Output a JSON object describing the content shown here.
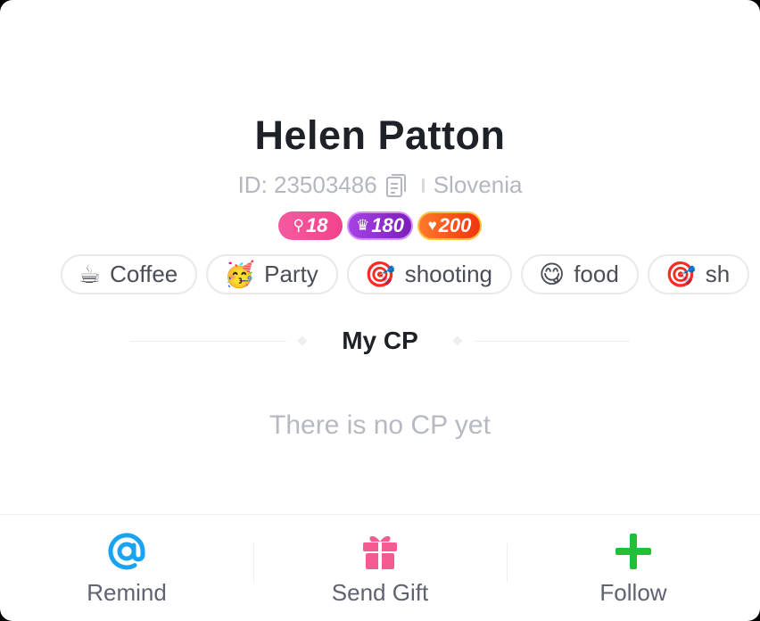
{
  "profile": {
    "name": "Helen Patton",
    "id_text": "ID: 23503486",
    "country": "Slovenia"
  },
  "badges": [
    {
      "icon": "female-icon",
      "glyph": "⚲",
      "value": "18"
    },
    {
      "icon": "crown-icon",
      "glyph": "♛",
      "value": "180"
    },
    {
      "icon": "heart-icon",
      "glyph": "♥",
      "value": "200"
    }
  ],
  "tags": [
    {
      "emoji": "☕",
      "label": "Coffee"
    },
    {
      "emoji": "🥳",
      "label": "Party"
    },
    {
      "emoji": "🎯",
      "label": "shooting"
    },
    {
      "emoji": "😋",
      "label": "food"
    },
    {
      "emoji": "🎯",
      "label": "sh"
    }
  ],
  "cp": {
    "title": "My CP",
    "empty_text": "There is no CP yet"
  },
  "actions": {
    "remind": "Remind",
    "send_gift": "Send Gift",
    "follow": "Follow"
  },
  "colors": {
    "remind": "#1aa3f0",
    "gift": "#f45b93",
    "follow": "#22c03a"
  }
}
